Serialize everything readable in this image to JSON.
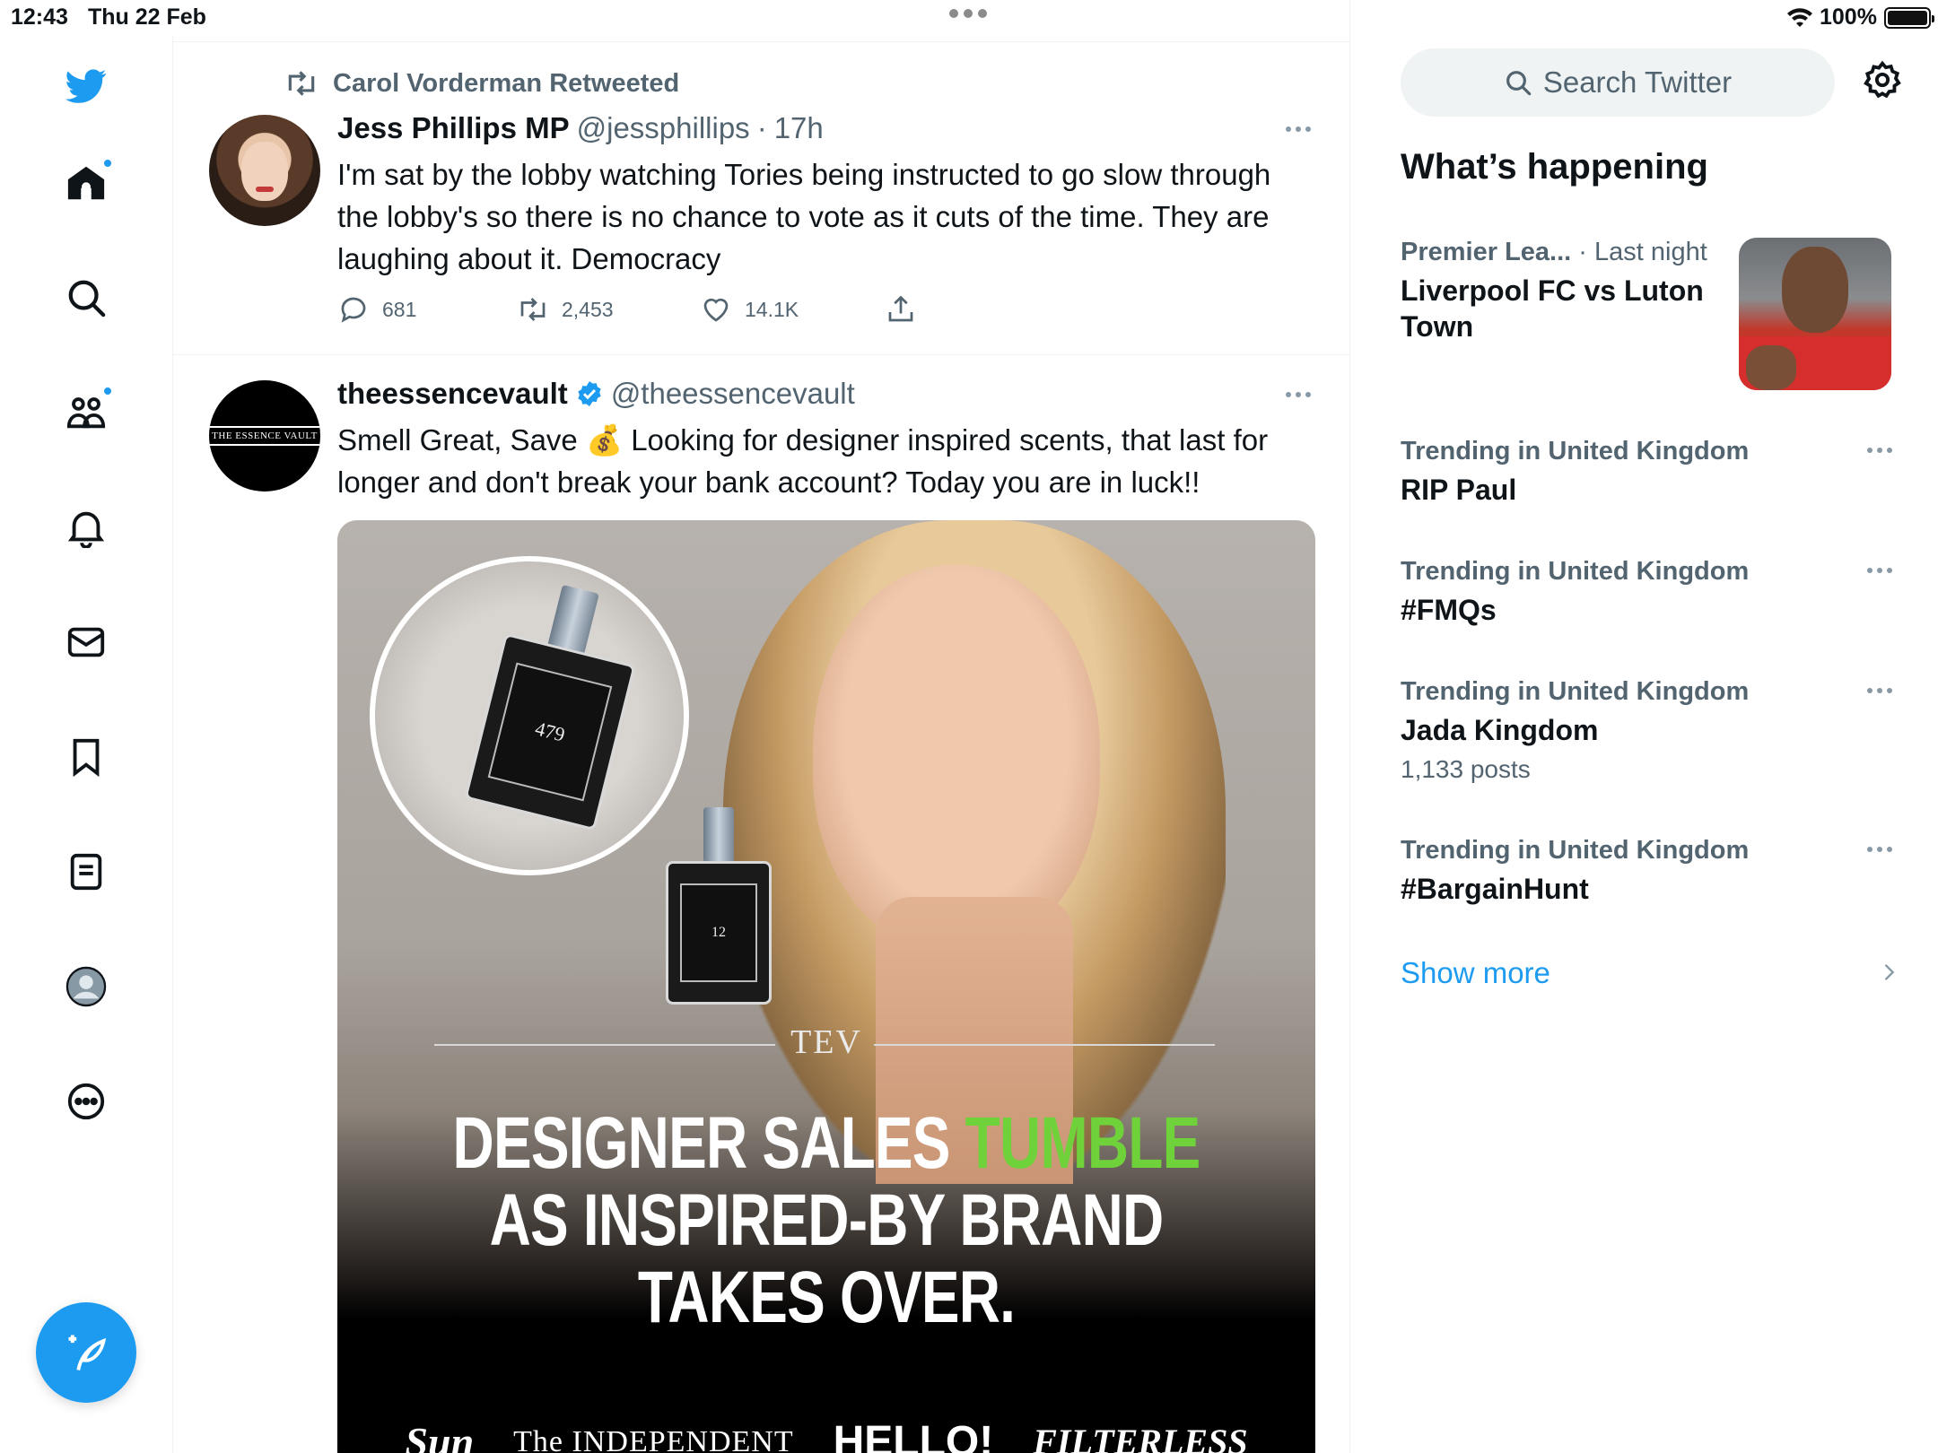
{
  "status_bar": {
    "time": "12:43",
    "date": "Thu 22 Feb",
    "battery": "100%"
  },
  "nav": {
    "items": [
      {
        "name": "logo",
        "icon": "twitter-bird-icon"
      },
      {
        "name": "home",
        "icon": "home-icon",
        "has_dot": true
      },
      {
        "name": "explore",
        "icon": "search-icon"
      },
      {
        "name": "communities",
        "icon": "communities-icon",
        "has_dot": true
      },
      {
        "name": "notifications",
        "icon": "bell-icon"
      },
      {
        "name": "messages",
        "icon": "mail-icon"
      },
      {
        "name": "bookmarks",
        "icon": "bookmark-icon"
      },
      {
        "name": "lists",
        "icon": "lists-icon"
      },
      {
        "name": "profile",
        "icon": "profile-avatar-icon"
      },
      {
        "name": "more",
        "icon": "more-circle-icon"
      }
    ],
    "compose_icon": "compose-feather-icon"
  },
  "timeline": {
    "tweets": [
      {
        "retweeted_by": "Carol Vorderman Retweeted",
        "name": "Jess Phillips MP",
        "handle": "@jessphillips",
        "sep": "·",
        "time": "17h",
        "text": "I'm sat by the lobby watching Tories being instructed to go slow through the lobby's so there is no chance to vote as it cuts of the time. They are laughing about it.  Democracy",
        "replies": "681",
        "retweets": "2,453",
        "likes": "14.1K"
      },
      {
        "name": "theessencevault",
        "handle": "@theessencevault",
        "verified": true,
        "avatar_text": "THE ESSENCE VAULT",
        "text": "Smell Great, Save 💰 Looking for designer inspired scents, that last for longer and don't break your bank account? Today you are in luck!!",
        "media": {
          "bottle_1": "479",
          "bottle_2": "12",
          "brand_mark": "TEV",
          "headline_1a": "DESIGNER SALES ",
          "headline_1b": "TUMBLE",
          "headline_2": "AS INSPIRED-BY BRAND",
          "headline_3": "TAKES OVER.",
          "logos": [
            "Sun",
            "The INDEPENDENT",
            "HELLO!",
            "FILTERLESS"
          ]
        }
      }
    ]
  },
  "sidebar": {
    "search_placeholder": "Search Twitter",
    "title": "What’s happening",
    "trends": [
      {
        "context": "Premier Lea...",
        "context_time": "· Last night",
        "topic": "Liverpool FC vs Luton Town"
      },
      {
        "context": "Trending in United Kingdom",
        "topic": "RIP Paul"
      },
      {
        "context": "Trending in United Kingdom",
        "topic": "#FMQs"
      },
      {
        "context": "Trending in United Kingdom",
        "topic": "Jada Kingdom",
        "count": "1,133 posts"
      },
      {
        "context": "Trending in United Kingdom",
        "topic": "#BargainHunt"
      }
    ],
    "show_more": "Show more"
  },
  "colors": {
    "accent": "#1d9bf0",
    "text_primary": "#0f1419",
    "text_secondary": "#536471",
    "border": "#eff3f4"
  }
}
